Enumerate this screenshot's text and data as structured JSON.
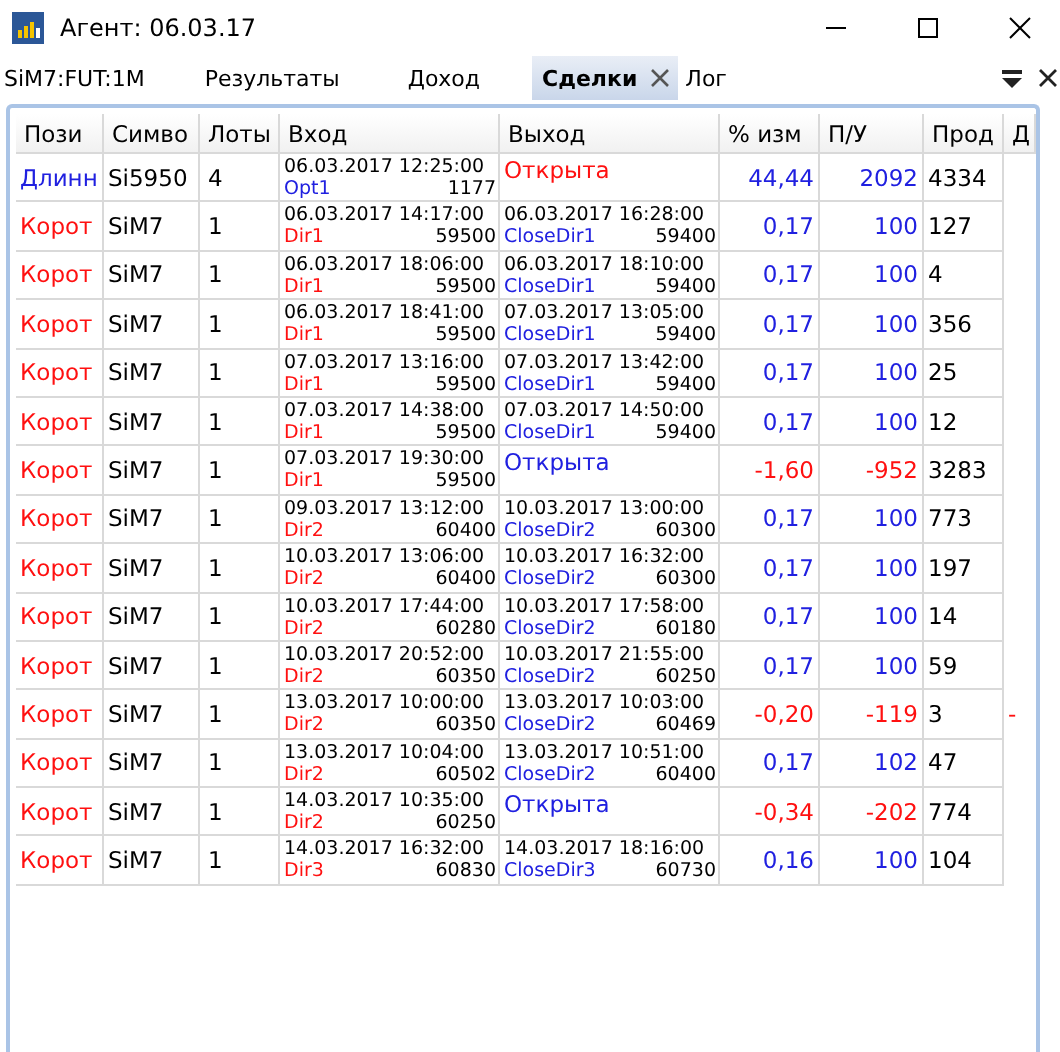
{
  "window": {
    "title": "Агент: 06.03.17"
  },
  "tabs": [
    {
      "label": "SiM7:FUT:1M",
      "selected": false,
      "closable": false
    },
    {
      "label": "Результаты",
      "selected": false,
      "closable": false
    },
    {
      "label": "Доход",
      "selected": false,
      "closable": false
    },
    {
      "label": "Сделки",
      "selected": true,
      "closable": true
    },
    {
      "label": "Лог",
      "selected": false,
      "closable": false
    }
  ],
  "table": {
    "columns": [
      "Пози",
      "Симво",
      "Лоты",
      "Вход",
      "Выход",
      "% изм",
      "П/У",
      "Прод",
      "Д"
    ],
    "rows": [
      {
        "position": {
          "text": "Длинн",
          "color": "#2020e0"
        },
        "symbol": "Si5950",
        "lots": "4",
        "entry_time": "06.03.2017 12:25:00",
        "entry_signal": {
          "text": "Opt1",
          "color": "#2020e0"
        },
        "entry_price": "1177",
        "exit": {
          "kind": "open",
          "text": "Открыта",
          "color": "#ff1010"
        },
        "change": {
          "text": "44,44",
          "color": "#2020e0"
        },
        "pl": {
          "text": "2092",
          "color": "#2020e0"
        },
        "bars": "4334"
      },
      {
        "position": {
          "text": "Корот",
          "color": "#ff1010"
        },
        "symbol": "SiM7",
        "lots": "1",
        "entry_time": "06.03.2017 14:17:00",
        "entry_signal": {
          "text": "Dir1",
          "color": "#ff1010"
        },
        "entry_price": "59500",
        "exit": {
          "kind": "closed",
          "time": "06.03.2017 16:28:00",
          "signal": "CloseDir1",
          "price": "59400"
        },
        "change": {
          "text": "0,17",
          "color": "#2020e0"
        },
        "pl": {
          "text": "100",
          "color": "#2020e0"
        },
        "bars": "127"
      },
      {
        "position": {
          "text": "Корот",
          "color": "#ff1010"
        },
        "symbol": "SiM7",
        "lots": "1",
        "entry_time": "06.03.2017 18:06:00",
        "entry_signal": {
          "text": "Dir1",
          "color": "#ff1010"
        },
        "entry_price": "59500",
        "exit": {
          "kind": "closed",
          "time": "06.03.2017 18:10:00",
          "signal": "CloseDir1",
          "price": "59400"
        },
        "change": {
          "text": "0,17",
          "color": "#2020e0"
        },
        "pl": {
          "text": "100",
          "color": "#2020e0"
        },
        "bars": "4"
      },
      {
        "position": {
          "text": "Корот",
          "color": "#ff1010"
        },
        "symbol": "SiM7",
        "lots": "1",
        "entry_time": "06.03.2017 18:41:00",
        "entry_signal": {
          "text": "Dir1",
          "color": "#ff1010"
        },
        "entry_price": "59500",
        "exit": {
          "kind": "closed",
          "time": "07.03.2017 13:05:00",
          "signal": "CloseDir1",
          "price": "59400"
        },
        "change": {
          "text": "0,17",
          "color": "#2020e0"
        },
        "pl": {
          "text": "100",
          "color": "#2020e0"
        },
        "bars": "356"
      },
      {
        "position": {
          "text": "Корот",
          "color": "#ff1010"
        },
        "symbol": "SiM7",
        "lots": "1",
        "entry_time": "07.03.2017 13:16:00",
        "entry_signal": {
          "text": "Dir1",
          "color": "#ff1010"
        },
        "entry_price": "59500",
        "exit": {
          "kind": "closed",
          "time": "07.03.2017 13:42:00",
          "signal": "CloseDir1",
          "price": "59400"
        },
        "change": {
          "text": "0,17",
          "color": "#2020e0"
        },
        "pl": {
          "text": "100",
          "color": "#2020e0"
        },
        "bars": "25"
      },
      {
        "position": {
          "text": "Корот",
          "color": "#ff1010"
        },
        "symbol": "SiM7",
        "lots": "1",
        "entry_time": "07.03.2017 14:38:00",
        "entry_signal": {
          "text": "Dir1",
          "color": "#ff1010"
        },
        "entry_price": "59500",
        "exit": {
          "kind": "closed",
          "time": "07.03.2017 14:50:00",
          "signal": "CloseDir1",
          "price": "59400"
        },
        "change": {
          "text": "0,17",
          "color": "#2020e0"
        },
        "pl": {
          "text": "100",
          "color": "#2020e0"
        },
        "bars": "12"
      },
      {
        "position": {
          "text": "Корот",
          "color": "#ff1010"
        },
        "symbol": "SiM7",
        "lots": "1",
        "entry_time": "07.03.2017 19:30:00",
        "entry_signal": {
          "text": "Dir1",
          "color": "#ff1010"
        },
        "entry_price": "59500",
        "exit": {
          "kind": "open",
          "text": "Открыта",
          "color": "#2020e0"
        },
        "change": {
          "text": "-1,60",
          "color": "#ff1010"
        },
        "pl": {
          "text": "-952",
          "color": "#ff1010"
        },
        "bars": "3283"
      },
      {
        "position": {
          "text": "Корот",
          "color": "#ff1010"
        },
        "symbol": "SiM7",
        "lots": "1",
        "entry_time": "09.03.2017 13:12:00",
        "entry_signal": {
          "text": "Dir2",
          "color": "#ff1010"
        },
        "entry_price": "60400",
        "exit": {
          "kind": "closed",
          "time": "10.03.2017 13:00:00",
          "signal": "CloseDir2",
          "price": "60300"
        },
        "change": {
          "text": "0,17",
          "color": "#2020e0"
        },
        "pl": {
          "text": "100",
          "color": "#2020e0"
        },
        "bars": "773"
      },
      {
        "position": {
          "text": "Корот",
          "color": "#ff1010"
        },
        "symbol": "SiM7",
        "lots": "1",
        "entry_time": "10.03.2017 13:06:00",
        "entry_signal": {
          "text": "Dir2",
          "color": "#ff1010"
        },
        "entry_price": "60400",
        "exit": {
          "kind": "closed",
          "time": "10.03.2017 16:32:00",
          "signal": "CloseDir2",
          "price": "60300"
        },
        "change": {
          "text": "0,17",
          "color": "#2020e0"
        },
        "pl": {
          "text": "100",
          "color": "#2020e0"
        },
        "bars": "197"
      },
      {
        "position": {
          "text": "Корот",
          "color": "#ff1010"
        },
        "symbol": "SiM7",
        "lots": "1",
        "entry_time": "10.03.2017 17:44:00",
        "entry_signal": {
          "text": "Dir2",
          "color": "#ff1010"
        },
        "entry_price": "60280",
        "exit": {
          "kind": "closed",
          "time": "10.03.2017 17:58:00",
          "signal": "CloseDir2",
          "price": "60180"
        },
        "change": {
          "text": "0,17",
          "color": "#2020e0"
        },
        "pl": {
          "text": "100",
          "color": "#2020e0"
        },
        "bars": "14"
      },
      {
        "position": {
          "text": "Корот",
          "color": "#ff1010"
        },
        "symbol": "SiM7",
        "lots": "1",
        "entry_time": "10.03.2017 20:52:00",
        "entry_signal": {
          "text": "Dir2",
          "color": "#ff1010"
        },
        "entry_price": "60350",
        "exit": {
          "kind": "closed",
          "time": "10.03.2017 21:55:00",
          "signal": "CloseDir2",
          "price": "60250"
        },
        "change": {
          "text": "0,17",
          "color": "#2020e0"
        },
        "pl": {
          "text": "100",
          "color": "#2020e0"
        },
        "bars": "59"
      },
      {
        "position": {
          "text": "Корот",
          "color": "#ff1010"
        },
        "symbol": "SiM7",
        "lots": "1",
        "entry_time": "13.03.2017 10:00:00",
        "entry_signal": {
          "text": "Dir2",
          "color": "#ff1010"
        },
        "entry_price": "60350",
        "exit": {
          "kind": "closed",
          "time": "13.03.2017 10:03:00",
          "signal": "CloseDir2",
          "price": "60469"
        },
        "change": {
          "text": "-0,20",
          "color": "#ff1010"
        },
        "pl": {
          "text": "-119",
          "color": "#ff1010"
        },
        "bars": "3",
        "column_9": {
          "text": "-",
          "color": "#ff1010"
        }
      },
      {
        "position": {
          "text": "Корот",
          "color": "#ff1010"
        },
        "symbol": "SiM7",
        "lots": "1",
        "entry_time": "13.03.2017 10:04:00",
        "entry_signal": {
          "text": "Dir2",
          "color": "#ff1010"
        },
        "entry_price": "60502",
        "exit": {
          "kind": "closed",
          "time": "13.03.2017 10:51:00",
          "signal": "CloseDir2",
          "price": "60400"
        },
        "change": {
          "text": "0,17",
          "color": "#2020e0"
        },
        "pl": {
          "text": "102",
          "color": "#2020e0"
        },
        "bars": "47"
      },
      {
        "position": {
          "text": "Корот",
          "color": "#ff1010"
        },
        "symbol": "SiM7",
        "lots": "1",
        "entry_time": "14.03.2017 10:35:00",
        "entry_signal": {
          "text": "Dir2",
          "color": "#ff1010"
        },
        "entry_price": "60250",
        "exit": {
          "kind": "open",
          "text": "Открыта",
          "color": "#2020e0"
        },
        "change": {
          "text": "-0,34",
          "color": "#ff1010"
        },
        "pl": {
          "text": "-202",
          "color": "#ff1010"
        },
        "bars": "774"
      },
      {
        "position": {
          "text": "Корот",
          "color": "#ff1010"
        },
        "symbol": "SiM7",
        "lots": "1",
        "entry_time": "14.03.2017 16:32:00",
        "entry_signal": {
          "text": "Dir3",
          "color": "#ff1010"
        },
        "entry_price": "60830",
        "exit": {
          "kind": "closed",
          "time": "14.03.2017 18:16:00",
          "signal": "CloseDir3",
          "price": "60730"
        },
        "change": {
          "text": "0,16",
          "color": "#2020e0"
        },
        "pl": {
          "text": "100",
          "color": "#2020e0"
        },
        "bars": "104"
      }
    ]
  }
}
